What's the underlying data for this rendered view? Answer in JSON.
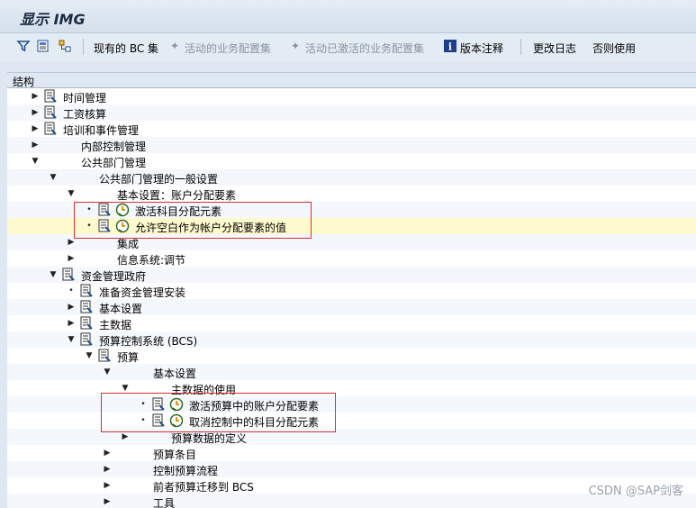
{
  "title": "显示 IMG",
  "toolbar": {
    "bc_sets": "现有的 BC 集",
    "active_bcsets": "活动的业务配置集",
    "activated_bcsets": "活动已激活的业务配置集",
    "release_notes": "版本注释",
    "change_log": "更改日志",
    "usage": "否则使用"
  },
  "tree": {
    "header": "结构",
    "rows": [
      {
        "level": 1,
        "arrow": "right",
        "doc": true,
        "clock": false,
        "label": "时间管理"
      },
      {
        "level": 1,
        "arrow": "right",
        "doc": true,
        "clock": false,
        "label": "工资核算"
      },
      {
        "level": 1,
        "arrow": "right",
        "doc": true,
        "clock": false,
        "label": "培训和事件管理"
      },
      {
        "level": 1,
        "arrow": "right",
        "doc": false,
        "clock": false,
        "label": "内部控制管理"
      },
      {
        "level": 1,
        "arrow": "down",
        "doc": false,
        "clock": false,
        "label": "公共部门管理"
      },
      {
        "level": 2,
        "arrow": "down",
        "doc": false,
        "clock": false,
        "label": "公共部门管理的一般设置"
      },
      {
        "level": 3,
        "arrow": "down",
        "doc": false,
        "clock": false,
        "label": "基本设置：账户分配要素"
      },
      {
        "level": 4,
        "arrow": "dot",
        "doc": true,
        "clock": true,
        "label": "激活科目分配元素"
      },
      {
        "level": 4,
        "arrow": "dot",
        "doc": true,
        "clock": true,
        "label": "允许空白作为帐户分配要素的值",
        "highlight": true
      },
      {
        "level": 3,
        "arrow": "right",
        "doc": false,
        "clock": false,
        "label": "集成"
      },
      {
        "level": 3,
        "arrow": "right",
        "doc": false,
        "clock": false,
        "label": "信息系统:调节"
      },
      {
        "level": 2,
        "arrow": "down",
        "doc": true,
        "clock": false,
        "label": "资金管理政府"
      },
      {
        "level": 3,
        "arrow": "dot",
        "doc": true,
        "clock": false,
        "label": "准备资金管理安装"
      },
      {
        "level": 3,
        "arrow": "right",
        "doc": true,
        "clock": false,
        "label": "基本设置"
      },
      {
        "level": 3,
        "arrow": "right",
        "doc": true,
        "clock": false,
        "label": "主数据"
      },
      {
        "level": 3,
        "arrow": "down",
        "doc": true,
        "clock": false,
        "label": "预算控制系统 (BCS)"
      },
      {
        "level": 4,
        "arrow": "down",
        "doc": true,
        "clock": false,
        "label": "预算"
      },
      {
        "level": 5,
        "arrow": "down",
        "doc": false,
        "clock": false,
        "label": "基本设置"
      },
      {
        "level": 6,
        "arrow": "down",
        "doc": false,
        "clock": false,
        "label": "主数据的使用"
      },
      {
        "level": 7,
        "arrow": "dot",
        "doc": true,
        "clock": true,
        "label": "激活预算中的账户分配要素"
      },
      {
        "level": 7,
        "arrow": "dot",
        "doc": true,
        "clock": true,
        "label": "取消控制中的科目分配元素"
      },
      {
        "level": 6,
        "arrow": "right",
        "doc": false,
        "clock": false,
        "label": "预算数据的定义"
      },
      {
        "level": 5,
        "arrow": "right",
        "doc": false,
        "clock": false,
        "label": "预算条目"
      },
      {
        "level": 5,
        "arrow": "right",
        "doc": false,
        "clock": false,
        "label": "控制预算流程"
      },
      {
        "level": 5,
        "arrow": "right",
        "doc": false,
        "clock": false,
        "label": "前者预算迁移到 BCS"
      },
      {
        "level": 5,
        "arrow": "right",
        "doc": false,
        "clock": false,
        "label": "工具"
      }
    ]
  },
  "watermark": "CSDN @SAP剑客",
  "colors": {
    "highlight_row": "#fffacd",
    "red_box": "#d9302c",
    "accent": "#1f4e8c"
  }
}
